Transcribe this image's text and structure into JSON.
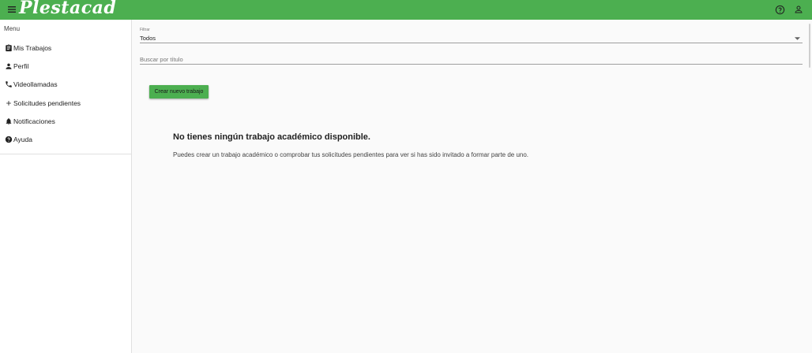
{
  "header": {
    "logo": "Plestacad",
    "menu_icon": "hamburger-menu-icon",
    "help_icon": "help-circle-icon",
    "account_icon": "person-icon",
    "bar_color": "#4caf50"
  },
  "sidebar": {
    "title": "Menu",
    "items": [
      {
        "label": "Mis Trabajos",
        "icon": "clipboard-icon"
      },
      {
        "label": "Perfil",
        "icon": "person-icon"
      },
      {
        "label": "Videollamadas",
        "icon": "phone-icon"
      },
      {
        "label": "Solicitudes pendientes",
        "icon": "plus-icon"
      },
      {
        "label": "Notificaciones",
        "icon": "bell-icon"
      },
      {
        "label": "Ayuda",
        "icon": "help-icon"
      }
    ]
  },
  "main": {
    "filter": {
      "label": "Filtrar",
      "selected": "Todos"
    },
    "search": {
      "placeholder": "Buscar por título",
      "value": ""
    },
    "create_button_label": "Crear nuevo trabajo",
    "empty_state": {
      "title": "No tienes ningún trabajo académico disponible.",
      "description": "Puedes crear un trabajo académico o comprobar tus solicitudes pendientes para ver si has sido invitado a formar parte de uno."
    }
  }
}
